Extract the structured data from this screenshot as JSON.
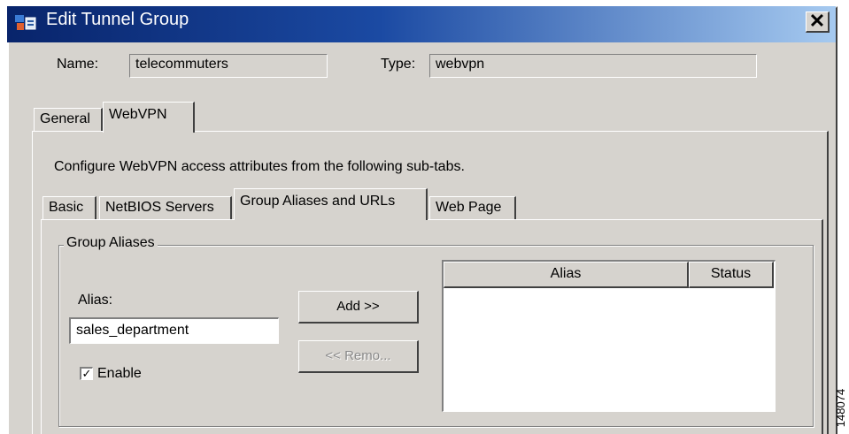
{
  "window": {
    "title": "Edit Tunnel Group",
    "close_symbol": "✕"
  },
  "header": {
    "name_label": "Name:",
    "name_value": "telecommuters",
    "type_label": "Type:",
    "type_value": "webvpn"
  },
  "tabs": [
    {
      "label": "General",
      "active": false
    },
    {
      "label": "WebVPN",
      "active": true
    }
  ],
  "webvpn": {
    "description": "Configure WebVPN access attributes from the following sub-tabs.",
    "subtabs": [
      {
        "label": "Basic",
        "active": false
      },
      {
        "label": "NetBIOS Servers",
        "active": false
      },
      {
        "label": "Group Aliases and URLs",
        "active": true
      },
      {
        "label": "Web Page",
        "active": false
      }
    ]
  },
  "group_aliases": {
    "legend": "Group Aliases",
    "alias_label": "Alias:",
    "alias_value": "sales_department",
    "enable_label": "Enable",
    "enable_checked": true,
    "add_button": "Add >>",
    "remove_button": "<< Remo...",
    "remove_enabled": false,
    "table": {
      "columns": [
        "Alias",
        "Status"
      ],
      "rows": []
    }
  },
  "figure_id": "148074",
  "icons": [
    "app-icon",
    "close-icon",
    "checkbox-check-icon"
  ]
}
